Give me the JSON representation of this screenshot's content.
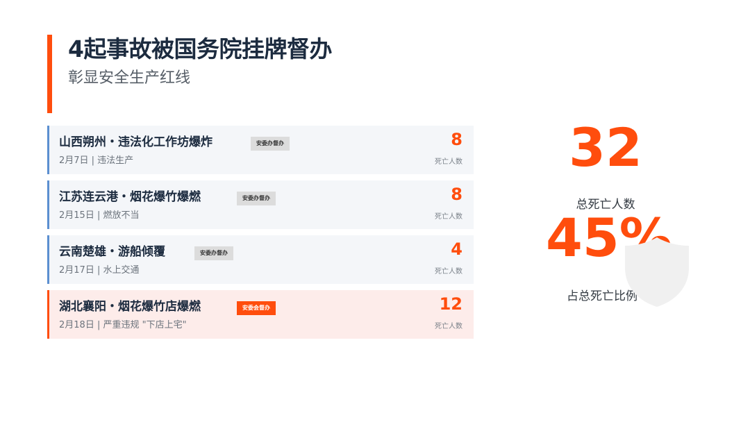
{
  "header": {
    "title": "4起事故被国务院挂牌督办",
    "subtitle": "彰显安全生产红线"
  },
  "cards": [
    {
      "title": "山西朔州・违法化工作坊爆炸",
      "tag": "安委办督办",
      "meta": "2月7日 | 违法生产",
      "deaths": "8",
      "deaths_label": "死亡人数"
    },
    {
      "title": "江苏连云港・烟花爆竹爆燃",
      "tag": "安委办督办",
      "meta": "2月15日 | 燃放不当",
      "deaths": "8",
      "deaths_label": "死亡人数"
    },
    {
      "title": "云南楚雄・游船倾覆",
      "tag": "安委办督办",
      "meta": "2月17日 | 水上交通",
      "deaths": "4",
      "deaths_label": "死亡人数"
    },
    {
      "title": "湖北襄阳・烟花爆竹店爆燃",
      "tag": "安委会督办",
      "meta": "2月18日 | 严重违规 \"下店上宅\"",
      "deaths": "12",
      "deaths_label": "死亡人数"
    }
  ],
  "stats": {
    "total_deaths": "32",
    "total_deaths_label": "总死亡人数",
    "percent": "45%",
    "percent_label": "占总死亡比例"
  },
  "colors": {
    "accent": "#ff4d0d",
    "card_border": "#5b8fd0",
    "card_bg": "#f4f6f9",
    "danger_bg": "#fdecea"
  },
  "icons": {
    "overlay": "shield-icon"
  }
}
